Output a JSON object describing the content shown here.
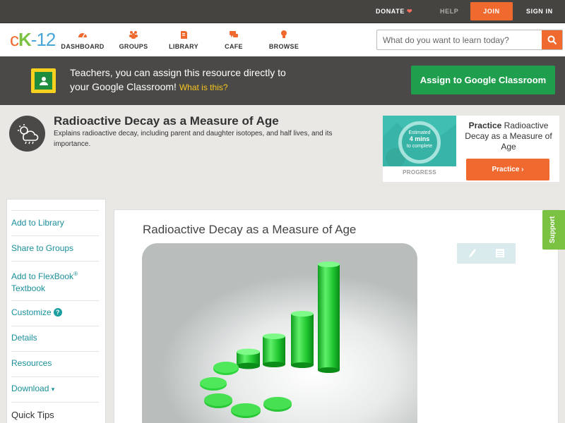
{
  "topbar": {
    "donate": "DONATE",
    "help": "HELP",
    "join": "JOIN",
    "signin": "SIGN IN"
  },
  "logo": {
    "c": "c",
    "k": "K",
    "dash": "-",
    "n": "12"
  },
  "nav": {
    "dashboard": "DASHBOARD",
    "groups": "GROUPS",
    "library": "LIBRARY",
    "cafe": "CAFE",
    "browse": "BROWSE"
  },
  "search": {
    "placeholder": "What do you want to learn today?"
  },
  "google_classroom": {
    "line1": "Teachers, you can assign this resource directly to",
    "line2": "your Google Classroom!",
    "what": "What is this?",
    "button": "Assign to Google Classroom"
  },
  "resource": {
    "title": "Radioactive Decay as a Measure of Age",
    "description": "Explains radioactive decay, including parent and daughter isotopes, and half lives, and its importance."
  },
  "practice": {
    "ring_line1": "Estimated",
    "ring_mins": "4 mins",
    "ring_line3": "to complete",
    "progress_label": "PROGRESS",
    "title_bold": "Practice",
    "title_rest": "Radioactive Decay as a Measure of Age",
    "button": "Practice"
  },
  "sidebar": {
    "items": [
      "Add to Library",
      "Share to Groups",
      "Add to FlexBook",
      "Textbook",
      "Customize",
      "Details",
      "Resources",
      "Download"
    ],
    "flexbook_mark": "®",
    "download_caret": "▾",
    "quick_tips": "Quick Tips"
  },
  "main": {
    "title": "Radioactive Decay as a Measure of Age"
  },
  "support": "Support",
  "colors": {
    "accent_orange": "#f06a30",
    "teal_link": "#1a8f9b",
    "google_green": "#1f9f4e",
    "support_green": "#7cc242"
  }
}
